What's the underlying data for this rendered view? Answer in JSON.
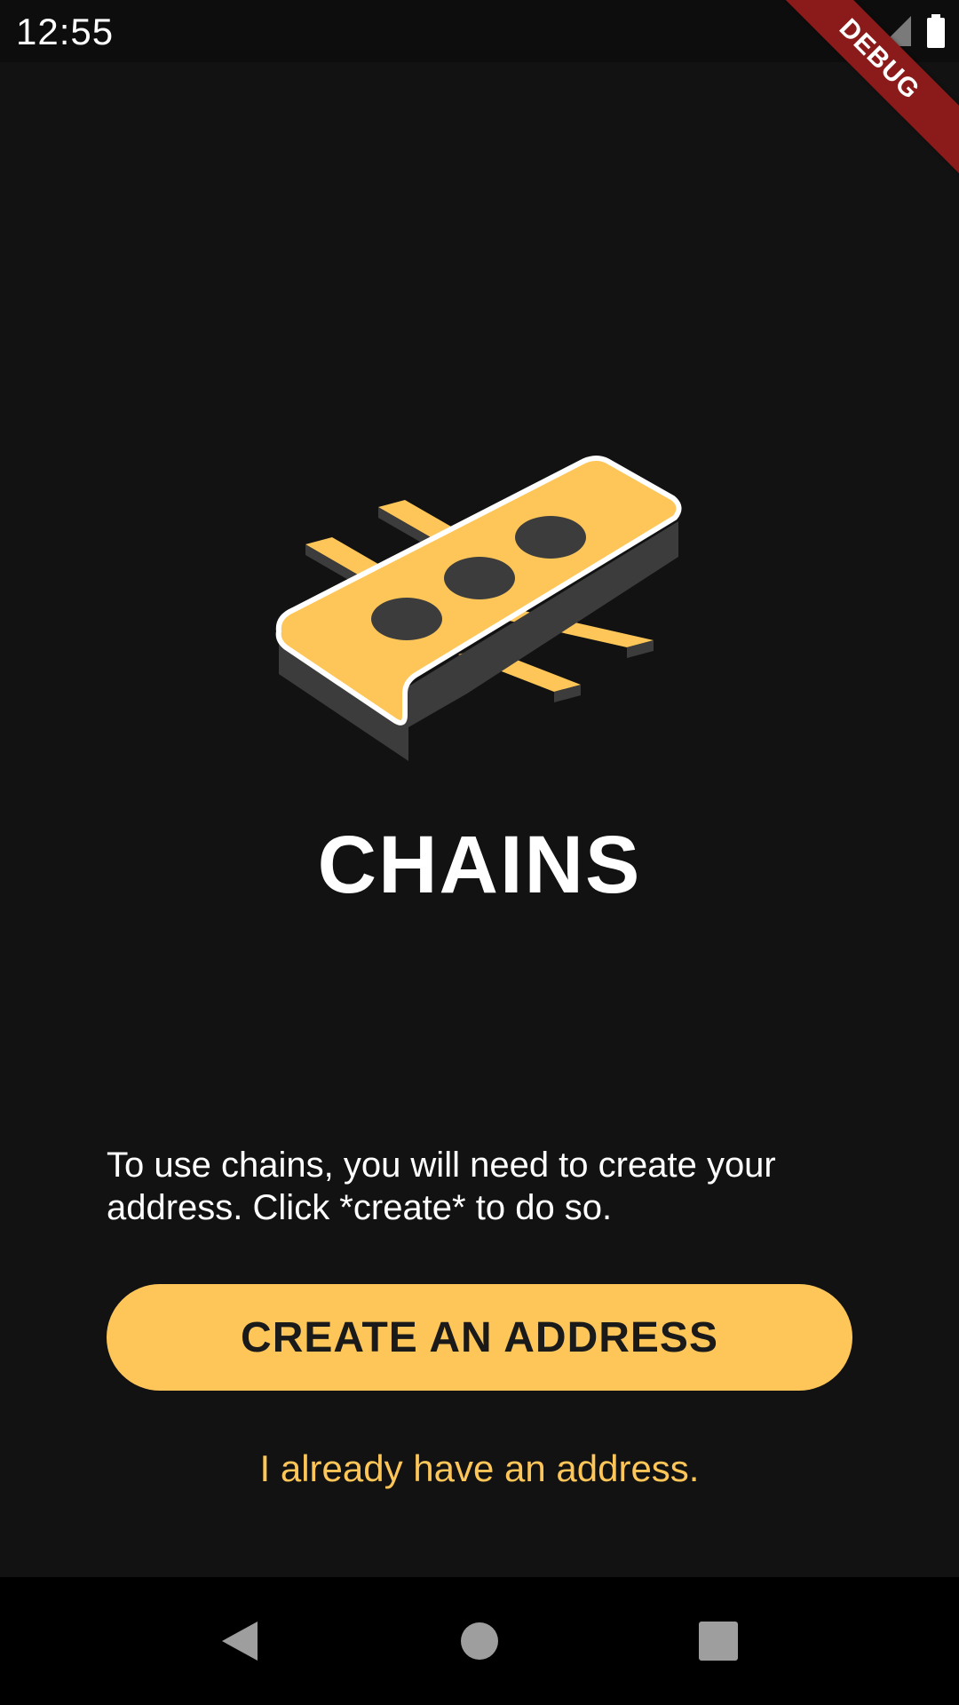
{
  "status_bar": {
    "time": "12:55",
    "icons": [
      "wifi-icon",
      "signal-icon",
      "battery-icon"
    ]
  },
  "debug_banner": "DEBUG",
  "logo": {
    "icon": "chains-logo-icon",
    "colors": {
      "primary": "#fec658",
      "dark": "#3c3c3c",
      "outline": "#ffffff"
    }
  },
  "title": "CHAINS",
  "intro": "To use chains, you will need to create your address. Click *create* to do so.",
  "create_button_label": "CREATE AN ADDRESS",
  "existing_link_label": "I already have an address.",
  "nav_bar": {
    "buttons": [
      "back-icon",
      "home-icon",
      "recents-icon"
    ]
  },
  "colors": {
    "accent": "#fec658",
    "background": "#121212",
    "debug": "#8b1a1a"
  }
}
